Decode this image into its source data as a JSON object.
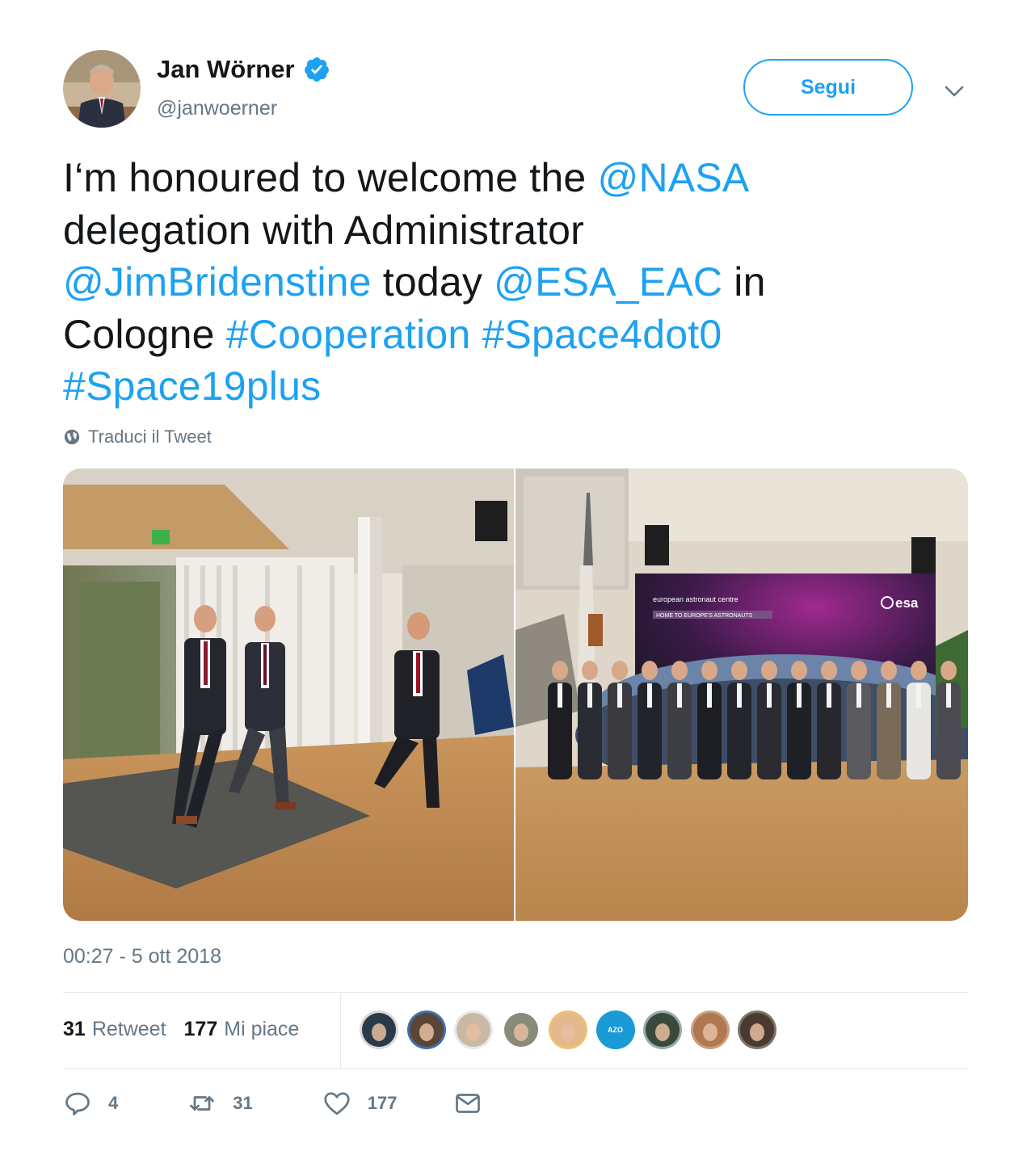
{
  "author": {
    "name": "Jan Wörner",
    "handle": "@janwoerner",
    "verified": true,
    "avatar_icon": "person-avatar"
  },
  "follow_button": {
    "label": "Segui"
  },
  "menu_icon": "chevron-down-icon",
  "tweet": {
    "segments": [
      {
        "text": "I‘m honoured to welcome the ",
        "link": false
      },
      {
        "text": "@NASA",
        "link": true
      },
      {
        "text": " delegation with Administrator ",
        "link": false
      },
      {
        "text": "@JimBridenstine",
        "link": true
      },
      {
        "text": " today ",
        "link": false
      },
      {
        "text": "@ESA_EAC",
        "link": true
      },
      {
        "text": " in Cologne ",
        "link": false
      },
      {
        "text": "#Cooperation",
        "link": true
      },
      {
        "text": " ",
        "link": false
      },
      {
        "text": "#Space4dot0",
        "link": true
      },
      {
        "text": " ",
        "link": false
      },
      {
        "text": "#Space19plus",
        "link": true
      }
    ]
  },
  "translate": {
    "label": "Traduci il Tweet",
    "icon": "globe-icon"
  },
  "media": {
    "photos": [
      {
        "id": "photo-entrance",
        "kind": "three men walking through building entrance"
      },
      {
        "id": "photo-group",
        "kind": "group photo in front of esa banner"
      }
    ],
    "banner": {
      "line1": "european astronaut centre",
      "line2": "HOME TO EUROPE'S ASTRONAUTS",
      "logo": "esa"
    }
  },
  "timestamp": "00:27 - 5 ott 2018",
  "stats": {
    "retweets_count": "31",
    "retweets_label": "Retweet",
    "likes_count": "177",
    "likes_label": "Mi piace"
  },
  "likers": [
    {
      "color": "#2b3a4a",
      "ring": "#d8d8d8"
    },
    {
      "color": "#5a4636",
      "ring": "#3d6fb0"
    },
    {
      "color": "#c9b9a4",
      "ring": "#e8e8e8"
    },
    {
      "color": "#8a8a7a",
      "ring": "#ffffff"
    },
    {
      "color": "#e3b88b",
      "ring": "#f0c070"
    },
    {
      "color": "#1a9ad6",
      "ring": "#1a9ad6",
      "text": "AZO"
    },
    {
      "color": "#3a4a3a",
      "ring": "#9aa"
    },
    {
      "color": "#b07850",
      "ring": "#c8a080"
    },
    {
      "color": "#4a3a32",
      "ring": "#776"
    }
  ],
  "actions": {
    "reply": {
      "icon": "reply-icon",
      "count": "4"
    },
    "retweet": {
      "icon": "retweet-icon",
      "count": "31"
    },
    "like": {
      "icon": "heart-icon",
      "count": "177"
    },
    "dm": {
      "icon": "envelope-icon"
    }
  },
  "colors": {
    "link": "#1da1f2",
    "secondary_text": "#657786",
    "primary_text": "#14171a",
    "divider": "#e1e8ed"
  }
}
